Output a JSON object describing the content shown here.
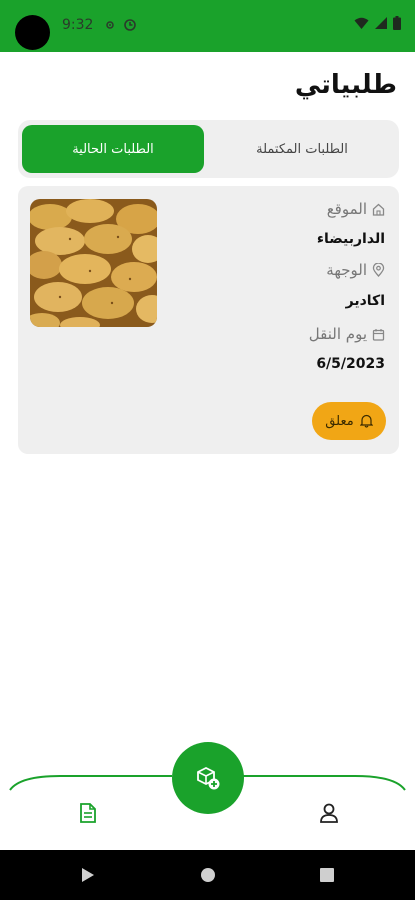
{
  "status_bar": {
    "time": "9:32"
  },
  "header": {
    "title": "طلبياتي"
  },
  "tabs": {
    "active": "الطلبات الحالية",
    "inactive": "الطلبات المكتملة"
  },
  "order": {
    "origin_label": "الموقع",
    "origin_value": "الداربيضاء",
    "destination_label": "الوجهة",
    "destination_value": "اكادير",
    "date_label": "يوم النقل",
    "date_value": "6/5/2023",
    "status": "معلق",
    "image_subject": "potatoes"
  },
  "bottom_nav": {
    "left_icon": "document-icon",
    "center_icon": "add-package-icon",
    "right_icon": "user-icon"
  },
  "colors": {
    "accent": "#1aa22b",
    "pending": "#f1a615",
    "card_bg": "#efefef"
  }
}
